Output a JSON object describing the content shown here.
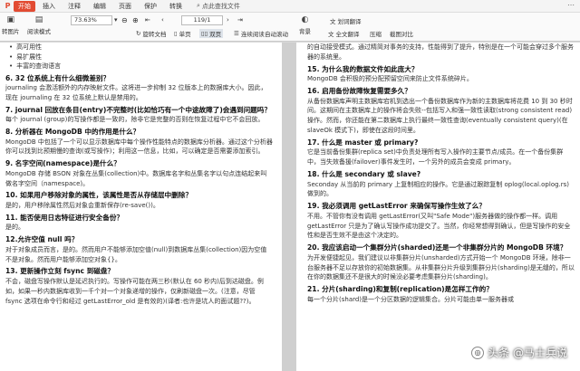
{
  "menubar": {
    "start_label": "开始",
    "items": [
      "插入",
      "注释",
      "编辑",
      "页面",
      "保护",
      "转换"
    ],
    "search_text": "点此查找文件"
  },
  "toolbar": {
    "left_tools": [
      {
        "icon": "convert-icon",
        "label": "转图片"
      },
      {
        "icon": "read-icon",
        "label": "阅读模式"
      }
    ],
    "zoom_value": "73.63%",
    "page_value": "119",
    "page_total": "/1",
    "rotate_label": "旋转文档",
    "single_label": "单页",
    "double_label": "双页",
    "continuous_label": "连续阅读",
    "autoscroll_label": "自动滚动",
    "background_label": "背景",
    "fulltext_translate": "全文翻译",
    "compress": "压缩",
    "screenshot_compare": "截图对比",
    "word_translate": "划词翻译"
  },
  "left_page": {
    "bullets": [
      "高可用性",
      "易扩展性",
      "丰富的查询语言"
    ],
    "sections": [
      {
        "q": "6. 32 位系统上有什么细微差别？",
        "a": "journaling 会激活额外的内存映射文件。这将进一步抑制 32 位版本上的数据库大小。因此，现在 journaling 在 32 位系统上默认是禁用的。"
      },
      {
        "q": "7. journal 回放在条目(entry)不完整时(比如恰巧有一个中途故障了)会遇到问题吗？",
        "a": "每个 journal (group)的写操作都是一致的，除非它是完整的否则在恢复过程中它不会回放。"
      },
      {
        "q": "8. 分析器在 MongoDB 中的作用是什么？",
        "a": "MongoDB 中包括了一个可以显示数据库中每个操作性能特点的数据库分析器。通过这个分析器你可以找到比预期慢的查询(或写操作)；利用这一信息，比如，可以确定是否需要添加索引。"
      },
      {
        "q": "9. 名字空间(namespace)是什么？",
        "a": "MongoDB 存储 BSON 对象在丛集(collection)中。数据库名字和丛集名字以句点连结起来叫做名字空间（namespace)。"
      },
      {
        "q": "10. 如果用户移除对象的属性，该属性是否从存储层中删除？",
        "a": "是的，用户移除属性然后对象会重新保存(re-save())。"
      },
      {
        "q": "11. 能否使用日志特征进行安全备份？",
        "a": "是的。"
      },
      {
        "q": "12.允许空值 null 吗？",
        "a": "对于对象成员而言，是的。然而用户不能够添加空值(null)到数据库丛集(collection)因为空值不是对象。然而用户能够添加空对象{}。"
      },
      {
        "q": "13. 更新操作立刻 fsync 到磁盘？",
        "a": "不会，磁盘写操作默认是延迟执行的。写操作可能在两三秒(默认在 60 秒内)后到达磁盘。例如，如果一秒内数据库收到一千个对一个对象递增的操作，仅刷新磁盘一次。(注意，尽管 fsync 选项在命令行和经过 getLastError_old 是有效的)(译者:也许是坑人的面试题??)。"
      }
    ]
  },
  "right_page": {
    "intro": "的自动接受模式。通过精简对事务的支持，性能得到了提升，特别是在一个可能会穿过多个服务器的系统里。",
    "sections": [
      {
        "q": "15. 为什么我的数据文件如此庞大？",
        "a": "MongoDB 会积极的预分配预留空间来防止文件系统碎片。"
      },
      {
        "q": "16. 启用备份故障恢复需要多久？",
        "a": "从备份数据库声明主数据库宕机到选出一个备份数据库作为新的主数据库将花费 10 到 30 秒时间。这期间在主数据库上的操作将会失败--包括写入和强一致性读取(strong consistent read)操作。然而，你还能在第二数据库上执行最终一致性查询(eventually consistent query)(在 slaveOk 模式下)，即使在这段时间里。"
      },
      {
        "q": "17. 什么是 master 或 primary?",
        "a": "它是当前备份集群(replica set)中负责处理所有写入操作的主要节点/成员。在一个备份集群中，当失效备援(failover)事件发生时，一个另外的成员会变成 primary。"
      },
      {
        "q": "18. 什么是 secondary 或 slave?",
        "a": "Seconday 从当前的 primary 上复制相应的操作。它是通过跟踪复制 oplog(local.oplog.rs)做到的。"
      },
      {
        "q": "19. 我必须调用 getLastError 来确保写操作生效了么？",
        "a": "不用。不管你有没有调用 getLastError(又叫\"Safe Mode\")服务器做的操作都一样。调用 getLastError 只是为了确认写操作成功提交了。当然，你经常想得到确认，但是写操作的安全性和是否生效不是由这个决定的。"
      },
      {
        "q": "20. 我应该启动一个集群分片(sharded)还是一个非集群分片的 MongoDB 环境？",
        "a": "为开发便捷起见，我们建议以非集群分片(unsharded)方式开始一个 MongoDB 环境，除非一台服务器不足以存放你的初始数据集。从非集群分片升级到集群分片(sharding)是无缝的，所以在你的数据集还不是很大的时候没必要考虑集群分片(sharding)。"
      },
      {
        "q": "21. 分片(sharding)和复制(replication)是怎样工作的？",
        "a": "每一个分片(shard)是一个分区数据的逻辑集合。分片可能由单一服务器或"
      }
    ]
  },
  "watermark": "头条 @马士兵说"
}
